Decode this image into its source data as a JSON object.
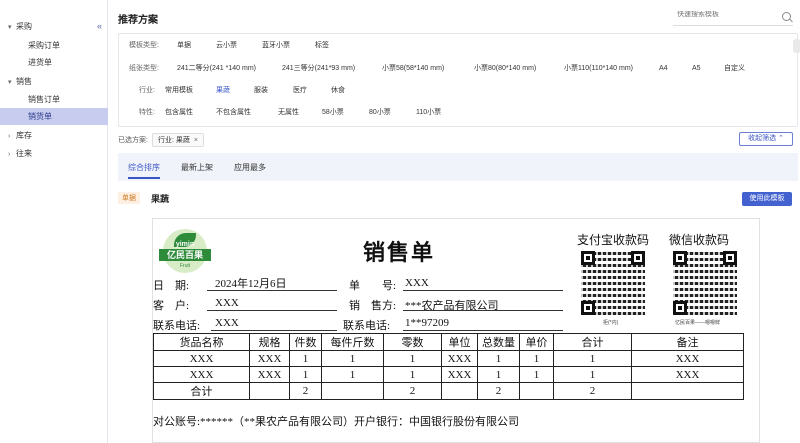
{
  "sidebar": {
    "collapse_icon": "double-chevron-left-icon",
    "groups": [
      {
        "label": "采购",
        "items": [
          "采购订单",
          "进货单"
        ]
      },
      {
        "label": "销售",
        "items": [
          "销售订单",
          "销货单"
        ]
      },
      {
        "label": "库存",
        "items": []
      },
      {
        "label": "往来",
        "items": []
      }
    ]
  },
  "header": {
    "title": "推荐方案",
    "search_placeholder": "快速搜索模板"
  },
  "filters": {
    "template_type": {
      "label": "模板类型:",
      "options": [
        "单据",
        "云小票",
        "蓝牙小票",
        "标签"
      ]
    },
    "paper_type": {
      "label": "纸张类型:",
      "options": [
        "241二等分(241 *140 mm)",
        "241三等分(241*93 mm)",
        "小票58(58*140 mm)",
        "小票80(80*140 mm)",
        "小票110(110*140 mm)",
        "A4",
        "A5",
        "自定义"
      ]
    },
    "industry": {
      "label": "行业:",
      "options": [
        "常用模板",
        "果蔬",
        "服装",
        "医疗",
        "休食"
      ],
      "selected": "果蔬"
    },
    "feature": {
      "label": "特性:",
      "options": [
        "包含属性",
        "不包含属性",
        "无属性",
        "58小票",
        "80小票",
        "110小票"
      ]
    }
  },
  "chosen": {
    "label": "已选方案:",
    "tag": "行业: 果蔬",
    "fold_label": "收起筛选"
  },
  "sort": {
    "options": [
      "综合排序",
      "最新上架",
      "应用最多"
    ],
    "active": "综合排序"
  },
  "template": {
    "badge": "单据",
    "name": "果蔬",
    "use_label": "使用此模板"
  },
  "receipt": {
    "logo": {
      "en": "yimin",
      "cn": "亿民百果",
      "small": "Fruit"
    },
    "title": "销售单",
    "alipay_label": "支付宝收款码",
    "wechat_label": "微信收款码",
    "alipay_caption": "拒(*内)",
    "wechat_caption": "亿民百果——嗯嗯鲜",
    "date_label": "日　期:",
    "date_value": "2024年12月6日",
    "order_label": "单　　号:",
    "order_value": "XXX",
    "customer_label": "客　户:",
    "customer_value": "XXX",
    "seller_label": "销　售方:",
    "seller_value": "***农产品有限公司",
    "contact_label": "联系电话:",
    "contact_value": "XXX",
    "seller_phone_label": "联系电话:",
    "seller_phone_value": "1**97209",
    "columns": [
      "货品名称",
      "规格",
      "件数",
      "每件斤数",
      "零数",
      "单位",
      "总数量",
      "单价",
      "合计",
      "备注"
    ],
    "rows": [
      [
        "XXX",
        "XXX",
        "1",
        "1",
        "1",
        "XXX",
        "1",
        "1",
        "1",
        "XXX"
      ],
      [
        "XXX",
        "XXX",
        "1",
        "1",
        "1",
        "XXX",
        "1",
        "1",
        "1",
        "XXX"
      ]
    ],
    "total_row": [
      "合计",
      "",
      "2",
      "",
      "2",
      "",
      "2",
      "",
      "2",
      ""
    ],
    "account_line": "对公账号:******（**果农产品有限公司）开户银行：中国银行股份有限公司"
  }
}
